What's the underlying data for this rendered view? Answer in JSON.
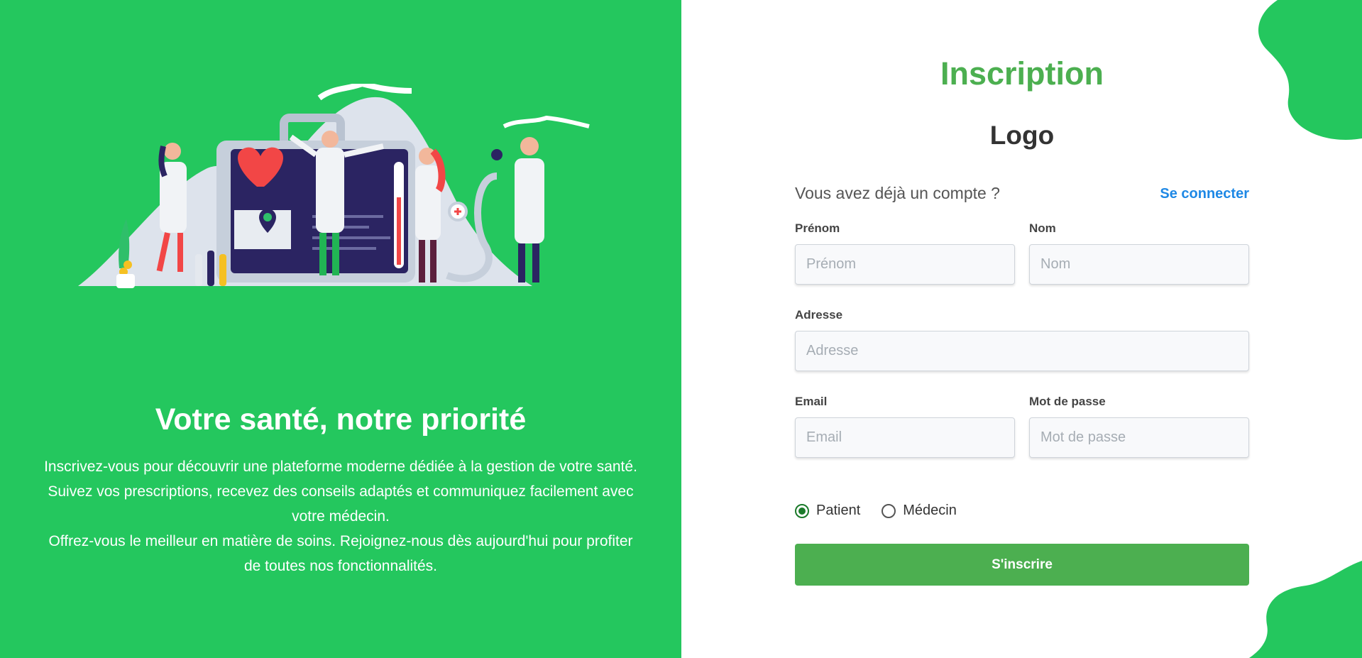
{
  "hero": {
    "title": "Votre santé, notre priorité",
    "paragraph_lines": [
      "Inscrivez-vous pour découvrir une plateforme moderne dédiée à la gestion de votre santé.",
      "Suivez vos prescriptions, recevez des conseils adaptés et communiquez facilement avec",
      "votre médecin.",
      "Offrez-vous le meilleur en matière de soins. Rejoignez-nous dès aujourd'hui pour profiter",
      "de toutes nos fonctionnalités."
    ]
  },
  "form": {
    "title": "Inscription",
    "logo": "Logo",
    "have_account": "Vous avez déjà un compte ?",
    "login_link": "Se connecter",
    "fields": {
      "prenom": {
        "label": "Prénom",
        "placeholder": "Prénom",
        "value": ""
      },
      "nom": {
        "label": "Nom",
        "placeholder": "Nom",
        "value": ""
      },
      "adresse": {
        "label": "Adresse",
        "placeholder": "Adresse",
        "value": ""
      },
      "email": {
        "label": "Email",
        "placeholder": "Email",
        "value": ""
      },
      "password": {
        "label": "Mot de passe",
        "placeholder": "Mot de passe",
        "value": ""
      }
    },
    "roles": [
      {
        "label": "Patient",
        "checked": true
      },
      {
        "label": "Médecin",
        "checked": false
      }
    ],
    "submit_label": "S'inscrire"
  },
  "colors": {
    "panel_green": "#24c75e",
    "accent_green": "#4caf50",
    "link_blue": "#1e88e5"
  },
  "icons": [
    "medical-team-illustration",
    "decorative-blob"
  ]
}
